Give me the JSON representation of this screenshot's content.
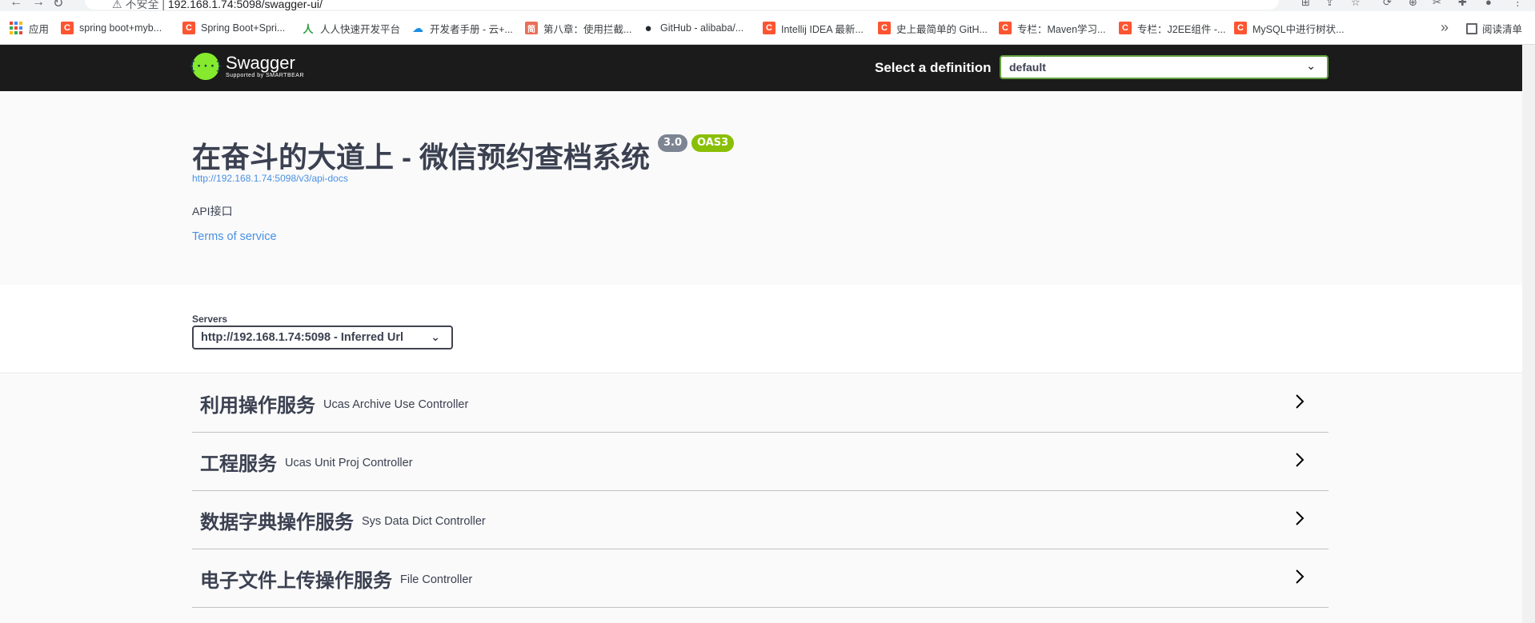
{
  "browser": {
    "url_warning": "不安全",
    "url_host": "192.168.1.74:5098/swagger-ui/",
    "bookmarks": [
      {
        "label": "应用",
        "icon": "apps-grid-icon"
      },
      {
        "label": "spring boot+myb...",
        "icon": "csdn-icon"
      },
      {
        "label": "Spring Boot+Spri...",
        "icon": "csdn-icon"
      },
      {
        "label": "人人快速开发平台",
        "icon": "renren-icon"
      },
      {
        "label": "开发者手册 - 云+...",
        "icon": "cloud-icon"
      },
      {
        "label": "第八章：使用拦截...",
        "icon": "jianshu-icon"
      },
      {
        "label": "GitHub - alibaba/...",
        "icon": "github-icon"
      },
      {
        "label": "Intellij IDEA 最新...",
        "icon": "csdn-icon"
      },
      {
        "label": "史上最简单的 GitH...",
        "icon": "csdn-icon"
      },
      {
        "label": "专栏：Maven学习...",
        "icon": "csdn-icon"
      },
      {
        "label": "专栏：J2EE组件 -...",
        "icon": "csdn-icon"
      },
      {
        "label": "MySQL中进行树状...",
        "icon": "csdn-icon"
      }
    ],
    "more": "»",
    "reading_list": "阅读清单"
  },
  "topbar": {
    "logo_name": "Swagger",
    "logo_sub": "Supported by SMARTBEAR",
    "select_label": "Select a definition",
    "select_value": "default"
  },
  "info": {
    "title": "在奋斗的大道上 - 微信预约查档系统",
    "version": "3.0",
    "oas": "OAS3",
    "api_docs_url": "http://192.168.1.74:5098/v3/api-docs",
    "description": "API接口",
    "terms": "Terms of service"
  },
  "servers": {
    "label": "Servers",
    "selected": "http://192.168.1.74:5098 - Inferred Url"
  },
  "tags": [
    {
      "name": "利用操作服务",
      "desc": "Ucas Archive Use Controller"
    },
    {
      "name": "工程服务",
      "desc": "Ucas Unit Proj Controller"
    },
    {
      "name": "数据字典操作服务",
      "desc": "Sys Data Dict Controller"
    },
    {
      "name": "电子文件上传操作服务",
      "desc": "File Controller"
    }
  ],
  "colors": {
    "topbar_bg": "#1b1b1b",
    "swagger_green": "#85ea2d",
    "oas_badge": "#89bf04",
    "version_badge": "#7d8492",
    "link": "#4990e2"
  }
}
